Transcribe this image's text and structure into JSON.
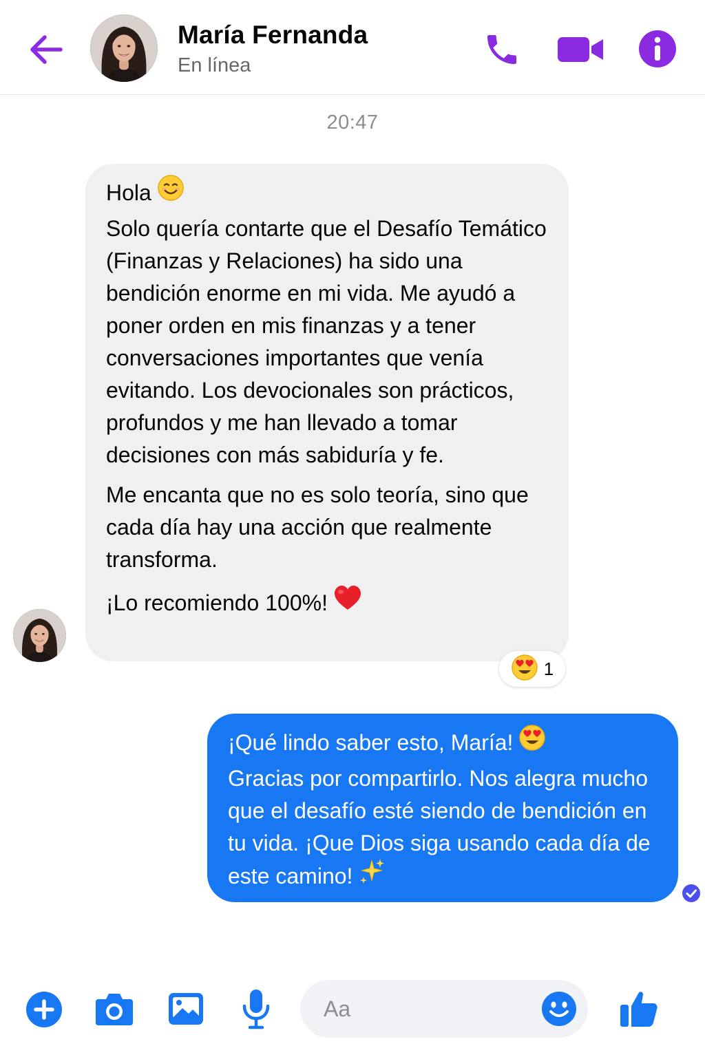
{
  "colors": {
    "accent_purple": "#8a2be2",
    "messenger_blue": "#1877f2",
    "incoming_bubble": "#f0f0f0",
    "secondary_text": "#65676b"
  },
  "header": {
    "contact_name": "María Fernanda",
    "status": "En línea",
    "icons": [
      "back-arrow-icon",
      "phone-icon",
      "video-camera-icon",
      "info-icon"
    ]
  },
  "conversation": {
    "timestamp": "20:47",
    "incoming": {
      "greeting": "Hola",
      "greeting_emoji": "smiling-face-emoji",
      "body": "Solo quería contarte que el Desafío Temático (Finanzas y Relaciones) ha sido una bendición enorme en mi vida. Me ayudó a poner orden en mis finanzas y a tener conversaciones importantes que venía evitando. Los devocionales son prácticos, profundos y me han llevado a tomar decisiones con más sabiduría y fe.",
      "paragraph2": "Me encanta que no es solo teoría, sino que cada día hay una acción que realmente transforma.",
      "closing": "¡Lo recomiendo 100%!",
      "closing_emoji": "red-heart-emoji",
      "reaction": {
        "emoji": "heart-eyes-emoji",
        "count": "1"
      }
    },
    "outgoing": {
      "first_line": "¡Qué lindo saber esto, María!",
      "first_line_emoji": "heart-eyes-emoji",
      "body": "Gracias por compartirlo. Nos alegra mucho que el desafío esté siendo de bendición en tu vida. ¡Que Dios siga usando cada día de este camino!",
      "closing_emoji": "sparkles-emoji",
      "status": "seen"
    }
  },
  "composer": {
    "placeholder": "Aa",
    "icons": [
      "plus-icon",
      "camera-icon",
      "gallery-icon",
      "microphone-icon",
      "emoji-icon",
      "thumbs-up-icon"
    ]
  }
}
